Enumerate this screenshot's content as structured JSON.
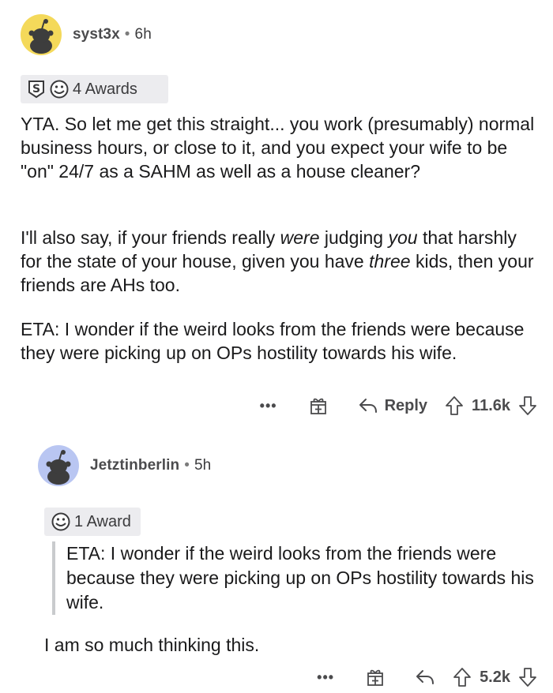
{
  "comments": [
    {
      "author": "syst3x",
      "separator": "•",
      "age": "6h",
      "awards_label": "4 Awards",
      "paragraphs": [
        "YTA. So let me get this straight... you work (presumably) normal business hours, or close to it, and you expect your wife to be \"on\" 24/7 as a SAHM as well as a house cleaner?"
      ],
      "p2_parts": [
        "I'll also say, if your friends really ",
        "were",
        " judging ",
        "you",
        " that harshly for the state of your house, given you have ",
        "three",
        " kids, then your friends are AHs too."
      ],
      "p3": "ETA: I wonder if the weird looks from the friends were because they were picking up on OPs hostility towards his wife.",
      "more_label": "•••",
      "reply_label": "Reply",
      "score": "11.6k"
    },
    {
      "author": "Jetztinberlin",
      "separator": "•",
      "age": "5h",
      "awards_label": "1 Award",
      "quote": "ETA: I wonder if the weird looks from the friends were because they were picking up on OPs hostility towards his wife.",
      "body": "I am so much thinking this.",
      "more_label": "•••",
      "score": "5.2k"
    }
  ],
  "colors": {
    "avatar1_bg": "#f4d95a",
    "avatar2_bg": "#b9c6f2",
    "award_pill_bg": "#ececef",
    "text": "#1a1a1b",
    "meta_text": "#4b4b4d"
  },
  "icons": [
    "snoo-avatar-icon",
    "silver-award-icon",
    "wholesome-award-icon",
    "gift-icon",
    "reply-arrow-icon",
    "upvote-arrow-icon",
    "downvote-arrow-icon"
  ]
}
